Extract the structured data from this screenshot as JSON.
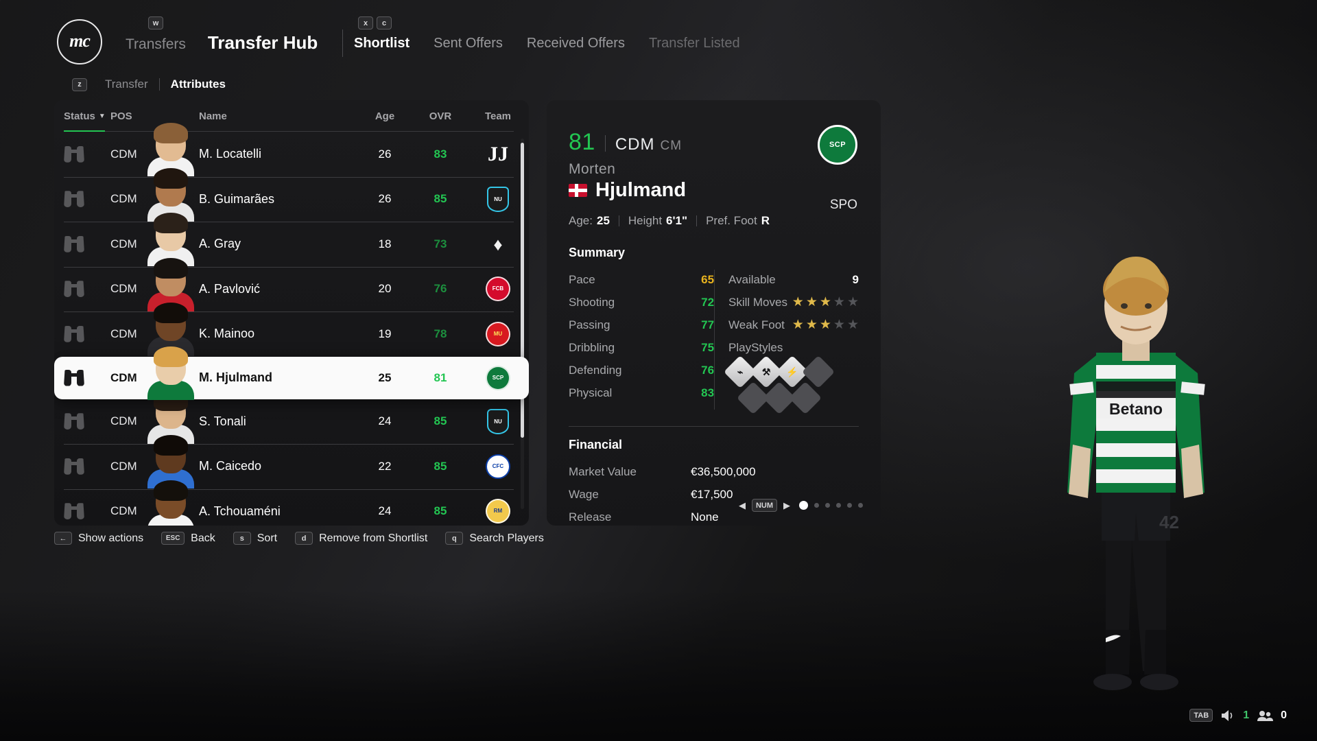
{
  "header": {
    "logo_text": "mc",
    "primary_nav": [
      {
        "label": "Transfers",
        "active": false,
        "key": "w"
      },
      {
        "label": "Transfer Hub",
        "active": true
      }
    ],
    "secondary_nav": [
      {
        "label": "Shortlist",
        "active": true,
        "key": "x"
      },
      {
        "label": "Sent Offers",
        "active": false,
        "key": "c"
      },
      {
        "label": "Received Offers",
        "active": false
      },
      {
        "label": "Transfer Listed",
        "active": false,
        "dim": true
      }
    ],
    "keycaps": {
      "transfers": "w",
      "shortlist": "x",
      "sent_offers": "c"
    }
  },
  "subnav": {
    "key": "z",
    "items": [
      {
        "label": "Transfer",
        "active": false
      },
      {
        "label": "Attributes",
        "active": true
      }
    ]
  },
  "list": {
    "columns": [
      "Status",
      "POS",
      "Name",
      "Age",
      "OVR",
      "Team"
    ],
    "sort_column": "Status",
    "sort_caret": "▼",
    "accent_color": "#23c552",
    "rows": [
      {
        "pos": "CDM",
        "name": "M. Locatelli",
        "age": "26",
        "ovr": "83",
        "ovr_color": "#23c552",
        "team": "Juventus",
        "crest": "juventus",
        "selected": false
      },
      {
        "pos": "CDM",
        "name": "B. Guimarães",
        "age": "26",
        "ovr": "85",
        "ovr_color": "#23c552",
        "team": "Newcastle United",
        "crest": "newcastle",
        "selected": false
      },
      {
        "pos": "CDM",
        "name": "A. Gray",
        "age": "18",
        "ovr": "73",
        "ovr_color": "#1c8f3e",
        "team": "Tottenham Hotspur",
        "crest": "tottenham",
        "selected": false
      },
      {
        "pos": "CDM",
        "name": "A. Pavlović",
        "age": "20",
        "ovr": "76",
        "ovr_color": "#1c8f3e",
        "team": "FC Bayern München",
        "crest": "bayern",
        "selected": false
      },
      {
        "pos": "CDM",
        "name": "K. Mainoo",
        "age": "19",
        "ovr": "78",
        "ovr_color": "#1c8f3e",
        "team": "Manchester United",
        "crest": "manutd",
        "selected": false
      },
      {
        "pos": "CDM",
        "name": "M. Hjulmand",
        "age": "25",
        "ovr": "81",
        "ovr_color": "#23c552",
        "team": "Sporting CP",
        "crest": "sporting",
        "selected": true
      },
      {
        "pos": "CDM",
        "name": "S. Tonali",
        "age": "24",
        "ovr": "85",
        "ovr_color": "#23c552",
        "team": "Newcastle United",
        "crest": "newcastle",
        "selected": false
      },
      {
        "pos": "CDM",
        "name": "M. Caicedo",
        "age": "22",
        "ovr": "85",
        "ovr_color": "#23c552",
        "team": "Chelsea",
        "crest": "chelsea",
        "selected": false
      },
      {
        "pos": "CDM",
        "name": "A. Tchouaméni",
        "age": "24",
        "ovr": "85",
        "ovr_color": "#23c552",
        "team": "Real Madrid",
        "crest": "realmadrid",
        "selected": false
      }
    ]
  },
  "actions": [
    {
      "key": "←",
      "label": "Show actions"
    },
    {
      "key": "ESC",
      "label": "Back"
    },
    {
      "key": "s",
      "label": "Sort"
    },
    {
      "key": "d",
      "label": "Remove from Shortlist"
    },
    {
      "key": "q",
      "label": "Search Players"
    }
  ],
  "detail": {
    "ovr": "81",
    "position_main": "CDM",
    "position_alt": "CM",
    "first_name": "Morten",
    "last_name": "Hjulmand",
    "nationality": "Denmark",
    "club_badge_text": "SCP",
    "club_short": "SPO",
    "bio": {
      "age_label": "Age:",
      "age_value": "25",
      "height_label": "Height",
      "height_value": "6'1\"",
      "foot_label": "Pref. Foot",
      "foot_value": "R"
    },
    "summary_title": "Summary",
    "summary_left": [
      {
        "label": "Pace",
        "value": "65",
        "color": "amber"
      },
      {
        "label": "Shooting",
        "value": "72",
        "color": "green"
      },
      {
        "label": "Passing",
        "value": "77",
        "color": "green"
      },
      {
        "label": "Dribbling",
        "value": "75",
        "color": "green"
      },
      {
        "label": "Defending",
        "value": "76",
        "color": "green"
      },
      {
        "label": "Physical",
        "value": "83",
        "color": "green"
      }
    ],
    "summary_right": {
      "available_label": "Available",
      "available_value": "9",
      "skill_moves_label": "Skill Moves",
      "skill_moves": 3,
      "weak_foot_label": "Weak Foot",
      "weak_foot": 3,
      "stars_total": 5,
      "playstyles_label": "PlayStyles",
      "playstyles_filled": 3,
      "playstyles_total": 7,
      "playstyle_icons": [
        "anticipate-icon",
        "bruiser-icon",
        "power-strike-icon"
      ]
    },
    "financial_title": "Financial",
    "financial": [
      {
        "label": "Market Value",
        "value": "€36,500,000"
      },
      {
        "label": "Wage",
        "value": "€17,500"
      },
      {
        "label": "Release",
        "value": "None"
      }
    ],
    "pager": {
      "left_arrow": "◀",
      "right_arrow": "▶",
      "key": "NUM",
      "pages": 6,
      "active_page": 1
    }
  },
  "statusbar": {
    "key": "TAB",
    "audio_value": "1",
    "players_value": "0"
  }
}
